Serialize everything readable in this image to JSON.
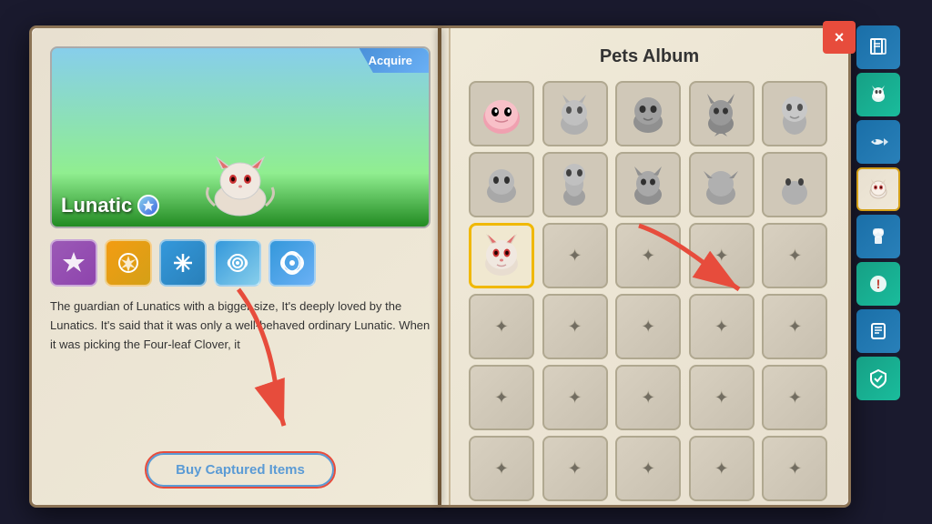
{
  "title": "Pets Album",
  "close_label": "×",
  "pet": {
    "name": "Lunatic",
    "acquired_label": "Acquire",
    "description": "The guardian of Lunatics with a bigger size, It's deeply loved by the Lunatics. It's said that it was only a well-behaved ordinary Lunatic. When it was picking the Four-leaf Clover, it",
    "skills": [
      {
        "id": "skill-1",
        "label": "⋆",
        "class": "skill-1"
      },
      {
        "id": "skill-2",
        "label": "✦",
        "class": "skill-2"
      },
      {
        "id": "skill-3",
        "label": "⚔",
        "class": "skill-3"
      },
      {
        "id": "skill-4",
        "label": "◎",
        "class": "skill-4"
      },
      {
        "id": "skill-5",
        "label": "✿",
        "class": "skill-5"
      }
    ]
  },
  "buy_button_label": "Buy Captured Items",
  "sidebar": {
    "items": [
      {
        "id": "book-icon",
        "label": "📖",
        "active": false
      },
      {
        "id": "cat-icon",
        "label": "🐱",
        "active": false
      },
      {
        "id": "fish-icon",
        "label": "🐟",
        "active": false
      },
      {
        "id": "pet-active-icon",
        "label": "🐾",
        "active": true
      },
      {
        "id": "chef-icon",
        "label": "👨‍🍳",
        "active": false
      },
      {
        "id": "alert-icon",
        "label": "❕",
        "active": false
      },
      {
        "id": "scroll-icon",
        "label": "📜",
        "active": false
      },
      {
        "id": "shield-icon",
        "label": "🛡",
        "active": false
      }
    ]
  },
  "grid": {
    "rows": 6,
    "cols": 5,
    "unlocked_slots": [
      0,
      1,
      2,
      3,
      4,
      5,
      6,
      7,
      8,
      9
    ],
    "selected_slot": 10,
    "pet_emojis": [
      "🌸",
      "🦊",
      "👻",
      "🐺",
      "👤",
      "🐰",
      "🧝",
      "🐈",
      "🦊",
      "🦅"
    ]
  },
  "colors": {
    "accent_blue": "#3498db",
    "accent_gold": "#f0b800",
    "close_red": "#e74c3c",
    "sidebar_blue": "#2980b9",
    "sidebar_teal": "#16a085"
  }
}
